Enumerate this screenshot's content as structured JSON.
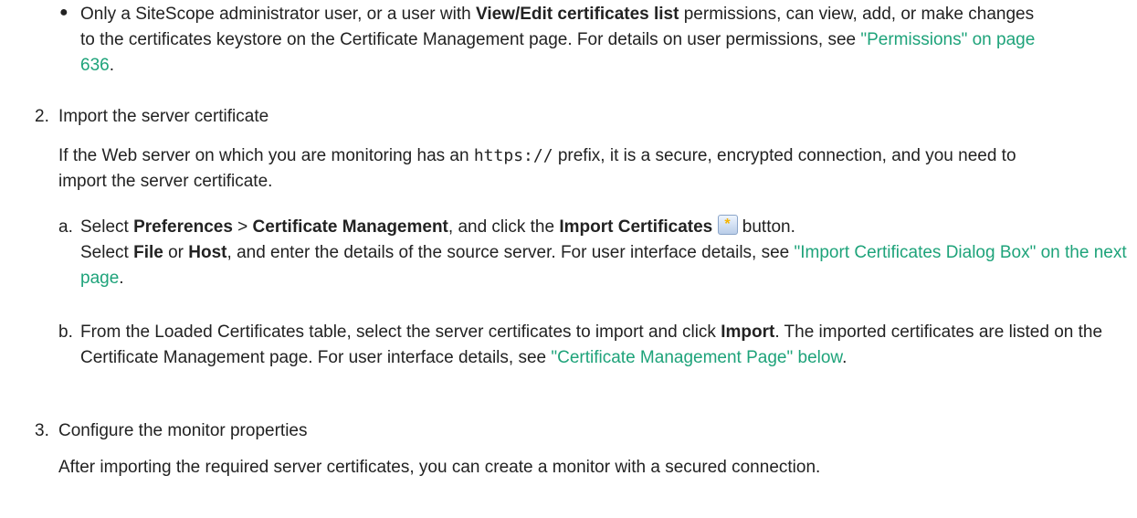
{
  "bullet": {
    "t1": "Only a SiteScope administrator user, or a user with ",
    "b1": "View/Edit certificates list",
    "t2": " permissions, can view, add, or make changes to the certificates keystore on the Certificate Management page. For details on user permissions, see ",
    "link": "\"Permissions\" on page 636",
    "t3": "."
  },
  "step2": {
    "num": "2.",
    "heading": "Import the server certificate",
    "p1": "If the Web server on which you are monitoring has an ",
    "code": "https://",
    "p2": " prefix, it is a secure, encrypted connection, and you need to import the server certificate."
  },
  "sub_a": {
    "letter": "a.",
    "t1": "Select ",
    "b1": "Preferences",
    "t2": " > ",
    "b2": "Certificate Management",
    "t3": ", and click the ",
    "b3": "Import Certificates",
    "t4": " button.",
    "t5": "Select ",
    "b4": "File",
    "t6": " or ",
    "b5": "Host",
    "t7": ", and enter the details of the source server. For user interface details, see ",
    "link": "\"Import Certificates Dialog Box\" on the next page",
    "t8": "."
  },
  "sub_b": {
    "letter": "b.",
    "t1": "From the Loaded Certificates table, select the server certificates to import and click ",
    "b1": "Import",
    "t2": ". The imported certificates are listed on the Certificate Management page. For user interface details, see ",
    "link": "\"Certificate Management Page\" below",
    "t3": "."
  },
  "step3": {
    "num": "3.",
    "heading": "Configure the monitor properties",
    "p1": "After importing the required server certificates, you can create a monitor with a secured connection."
  },
  "icons": {
    "import": "import-certificates-icon",
    "glyph": "*"
  },
  "colors": {
    "link": "#1ea37a",
    "text": "#222222"
  }
}
